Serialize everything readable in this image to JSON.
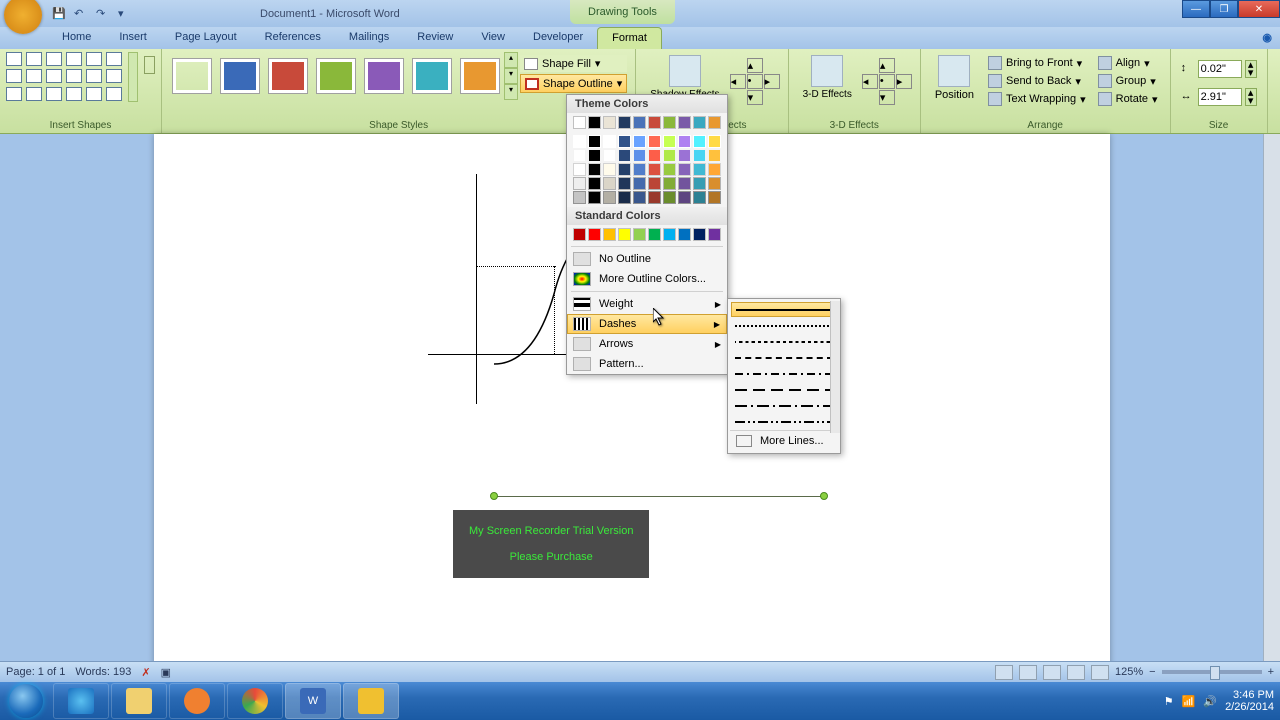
{
  "title": "Document1 - Microsoft Word",
  "context_tab": "Drawing Tools",
  "tabs": [
    "Home",
    "Insert",
    "Page Layout",
    "References",
    "Mailings",
    "Review",
    "View",
    "Developer",
    "Format"
  ],
  "active_tab": "Format",
  "groups": {
    "insert_shapes": "Insert Shapes",
    "shape_styles": "Shape Styles",
    "shadow": "Shadow Effects",
    "3d": "3-D Effects",
    "arrange": "Arrange",
    "size": "Size"
  },
  "shape_fill": "Shape Fill",
  "shape_outline": "Shape Outline",
  "shadow_btn": "Shadow Effects",
  "threed_btn": "3-D Effects",
  "position_btn": "Position",
  "arrange_items": {
    "front": "Bring to Front",
    "back": "Send to Back",
    "wrap": "Text Wrapping",
    "align": "Align",
    "group": "Group",
    "rotate": "Rotate"
  },
  "size": {
    "height": "0.02\"",
    "width": "2.91\""
  },
  "outline_menu": {
    "theme": "Theme Colors",
    "standard": "Standard Colors",
    "no_outline": "No Outline",
    "more_colors": "More Outline Colors...",
    "weight": "Weight",
    "dashes": "Dashes",
    "arrows": "Arrows",
    "pattern": "Pattern..."
  },
  "dashes_menu": {
    "more_lines": "More Lines..."
  },
  "style_colors": [
    "#000000",
    "#3a6ab8",
    "#c84a3a",
    "#8ab83a",
    "#8a5ab8",
    "#3ab0c0",
    "#e89830"
  ],
  "theme_colors_row": [
    "#ffffff",
    "#000000",
    "#eae4d6",
    "#223a60",
    "#4a72b8",
    "#c84a3a",
    "#8ab83a",
    "#7a5aa8",
    "#3aa8c0",
    "#e89830"
  ],
  "standard_colors": [
    "#c00000",
    "#ff0000",
    "#ffc000",
    "#ffff00",
    "#92d050",
    "#00b050",
    "#00b0f0",
    "#0070c0",
    "#002060",
    "#7030a0"
  ],
  "status": {
    "page": "Page: 1 of 1",
    "words": "Words: 193",
    "zoom": "125%"
  },
  "watermark": {
    "l1": "My Screen Recorder Trial Version",
    "l2": "Please Purchase"
  },
  "clock": {
    "time": "3:46 PM",
    "date": "2/26/2014"
  }
}
